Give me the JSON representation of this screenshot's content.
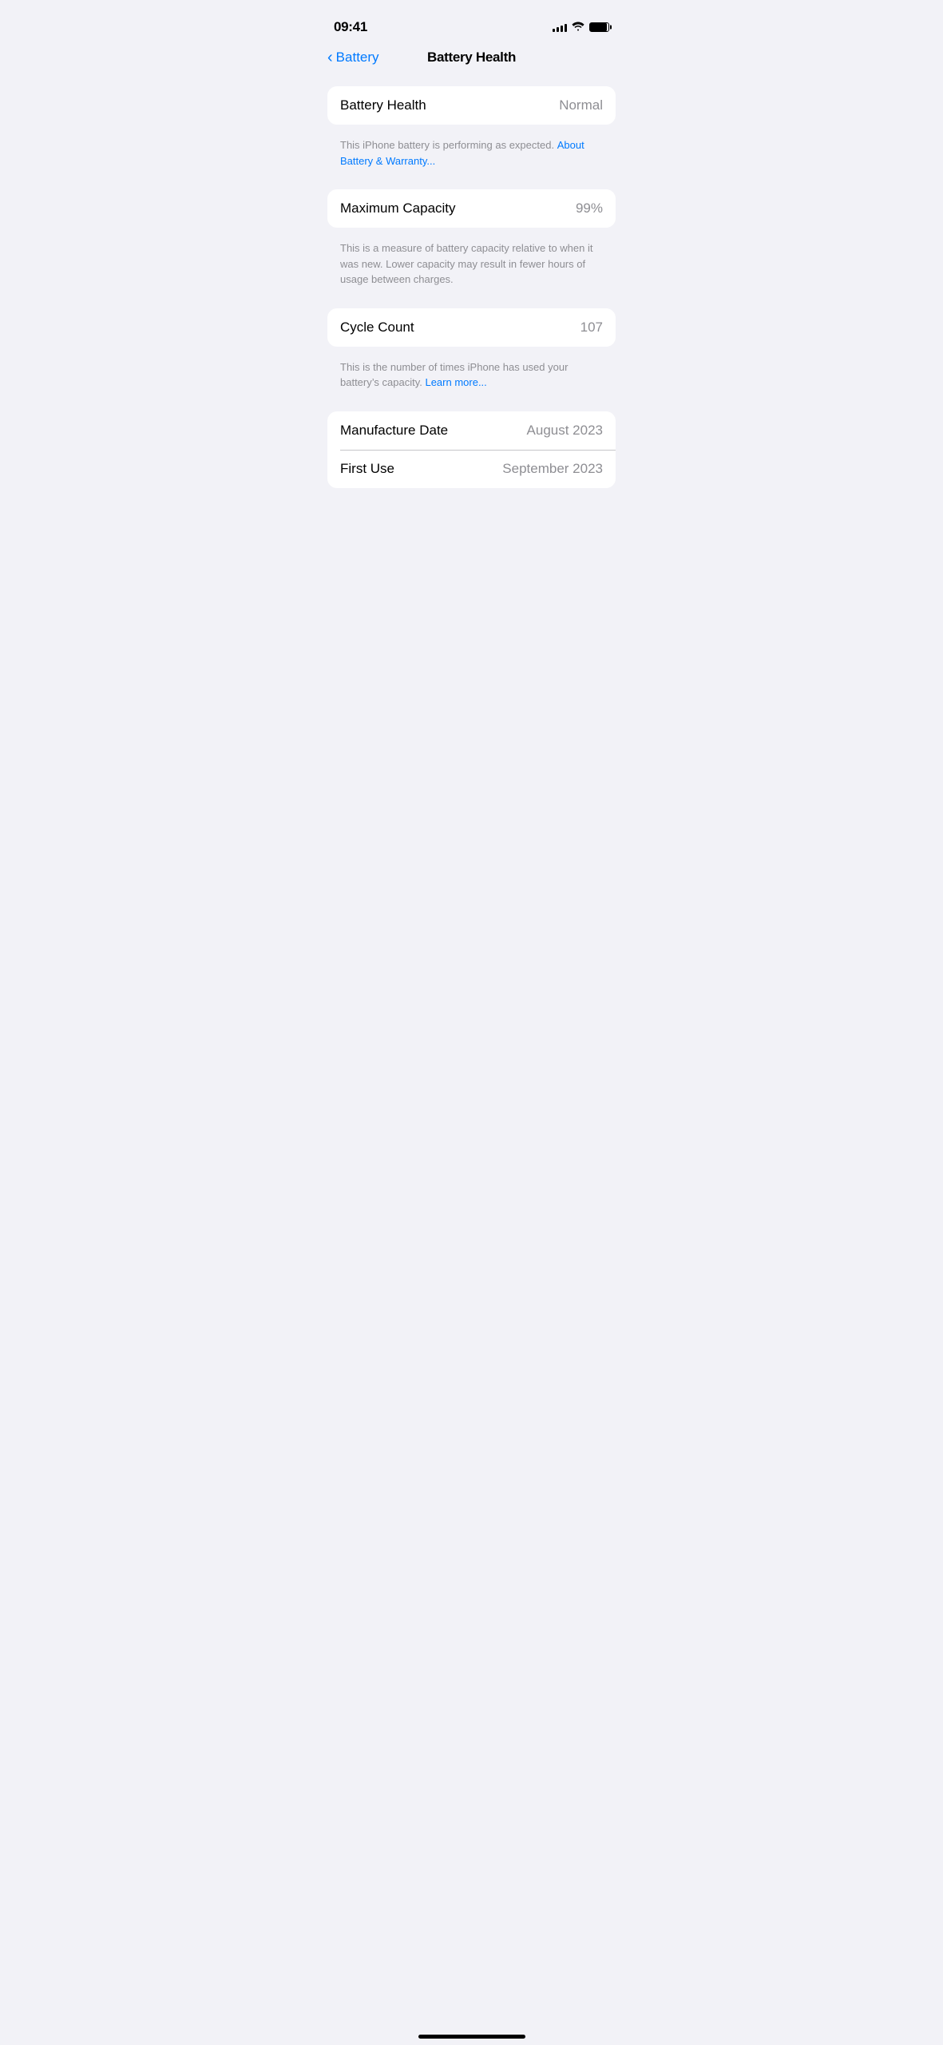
{
  "statusBar": {
    "time": "09:41",
    "signalBars": [
      4,
      6,
      8,
      10,
      12
    ],
    "batteryLevel": 90
  },
  "navigation": {
    "backLabel": "Battery",
    "title": "Battery Health"
  },
  "sections": [
    {
      "id": "battery-health-section",
      "card": {
        "rows": [
          {
            "label": "Battery Health",
            "value": "Normal"
          }
        ]
      },
      "description": {
        "text": "This iPhone battery is performing as expected. ",
        "linkText": "About Battery & Warranty...",
        "linkHref": "#"
      }
    },
    {
      "id": "maximum-capacity-section",
      "card": {
        "rows": [
          {
            "label": "Maximum Capacity",
            "value": "99%"
          }
        ]
      },
      "description": {
        "text": "This is a measure of battery capacity relative to when it was new. Lower capacity may result in fewer hours of usage between charges.",
        "linkText": null
      }
    },
    {
      "id": "cycle-count-section",
      "card": {
        "rows": [
          {
            "label": "Cycle Count",
            "value": "107"
          }
        ]
      },
      "description": {
        "text": "This is the number of times iPhone has used your battery’s capacity. ",
        "linkText": "Learn more...",
        "linkHref": "#"
      }
    },
    {
      "id": "dates-section",
      "card": {
        "rows": [
          {
            "label": "Manufacture Date",
            "value": "August 2023"
          },
          {
            "label": "First Use",
            "value": "September 2023"
          }
        ]
      },
      "description": null
    }
  ]
}
